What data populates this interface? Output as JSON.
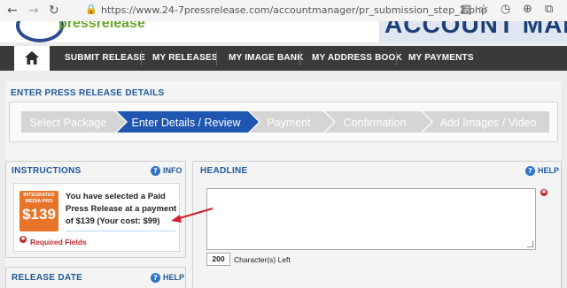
{
  "browser": {
    "url": "https://www.24-7pressrelease.com/accountmanager/pr_submission_step_2.php",
    "icons": [
      "back-arrow-icon",
      "forward-arrow-icon",
      "reload-icon",
      "page-info-icon",
      "lock-icon",
      "reader-icon",
      "star-icon",
      "history-icon",
      "globe-icon",
      "extensions-icon"
    ]
  },
  "site": {
    "logo_text": "pressrelease",
    "banner_text": "ACCOUNT MANAGER"
  },
  "nav": {
    "items": [
      "SUBMIT RELEASE",
      "MY RELEASES",
      "MY IMAGE BANK",
      "MY ADDRESS BOOK",
      "MY PAYMENTS"
    ]
  },
  "details": {
    "title": "ENTER PRESS RELEASE DETAILS",
    "steps": [
      "Select Package",
      "Enter Details / Review",
      "Payment",
      "Confirmation",
      "Add Images / Video"
    ],
    "active_step": "Enter Details / Review",
    "colors": {
      "active": "#1f56b0",
      "inactive": "#d5d5d5"
    }
  },
  "instructions": {
    "title": "INSTRUCTIONS",
    "info_label": "INFO",
    "badge_line1": "INTEGRATED",
    "badge_line2": "MEDIA PRO",
    "badge_price": "$139",
    "text": "You have selected a Paid Press Release at a payment of $139 (Your cost: $99)",
    "required_label": "Required Fields"
  },
  "headline": {
    "title": "HEADLINE",
    "help_label": "HELP",
    "value": "",
    "char_count": "200",
    "char_label": "Character(s) Left"
  },
  "release_date": {
    "title": "RELEASE DATE",
    "help_label": "HELP"
  }
}
